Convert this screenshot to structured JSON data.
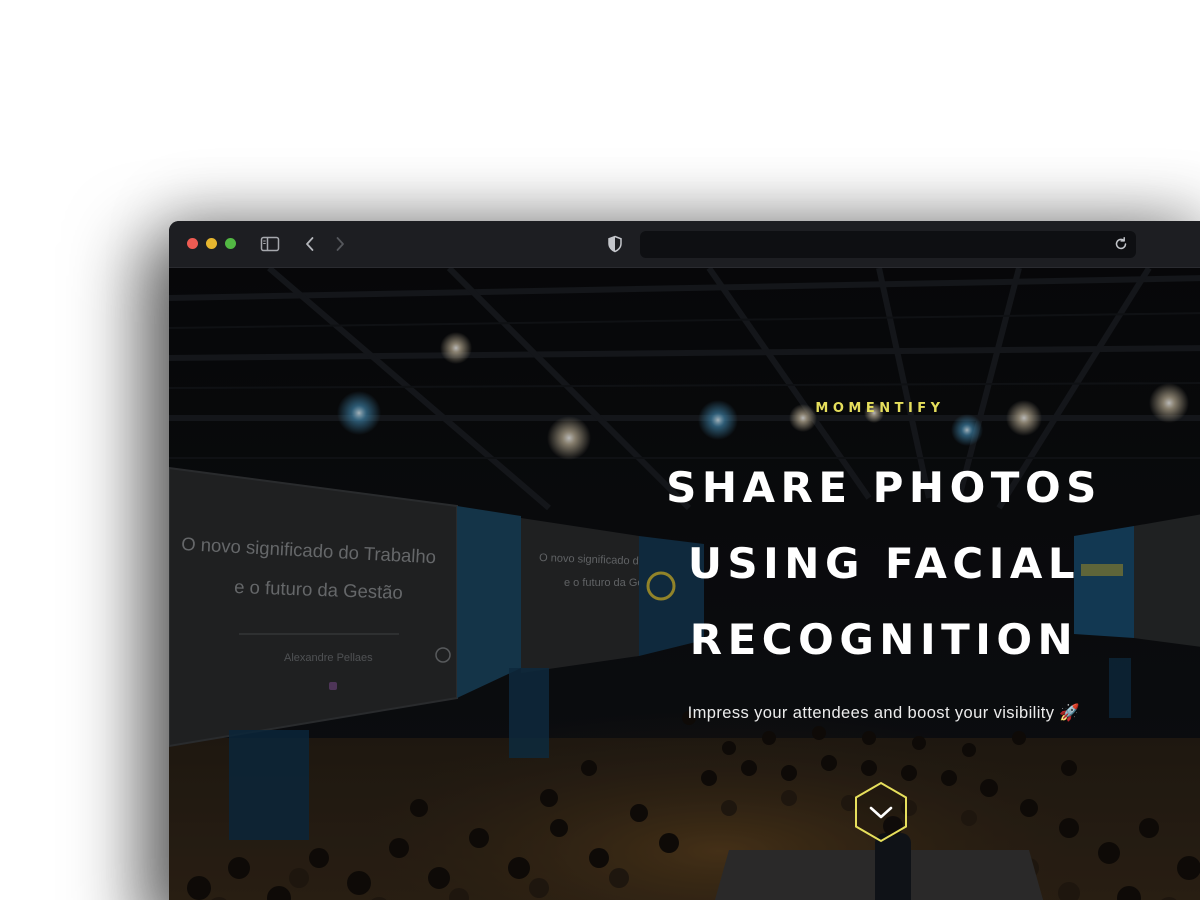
{
  "browser": {
    "traffic_lights": {
      "close": "#ee5b53",
      "minimize": "#e6b62f",
      "zoom": "#52b843"
    },
    "sidebar_icon": "sidebar-toggle-icon",
    "back_icon": "chevron-left-icon",
    "forward_icon": "chevron-right-icon",
    "privacy_icon": "shield-icon",
    "address_value": "",
    "reload_icon": "reload-icon"
  },
  "hero": {
    "brand": "MOMENTIFY",
    "headline": [
      "SHARE PHOTOS",
      "USING FACIAL",
      "RECOGNITION"
    ],
    "subtitle": "Impress your attendees and boost your visibility 🚀",
    "cta_icon": "hexagon-chevron-down-icon",
    "background": {
      "slide_title_line1": "O novo significado do Trabalho",
      "slide_title_line2": "e o futuro da Gestão",
      "presenter": "Alexandre Pellaes"
    }
  },
  "colors": {
    "brand_accent": "#e6df5c",
    "headline": "#ffffff",
    "titlebar": "#1d1e22"
  }
}
